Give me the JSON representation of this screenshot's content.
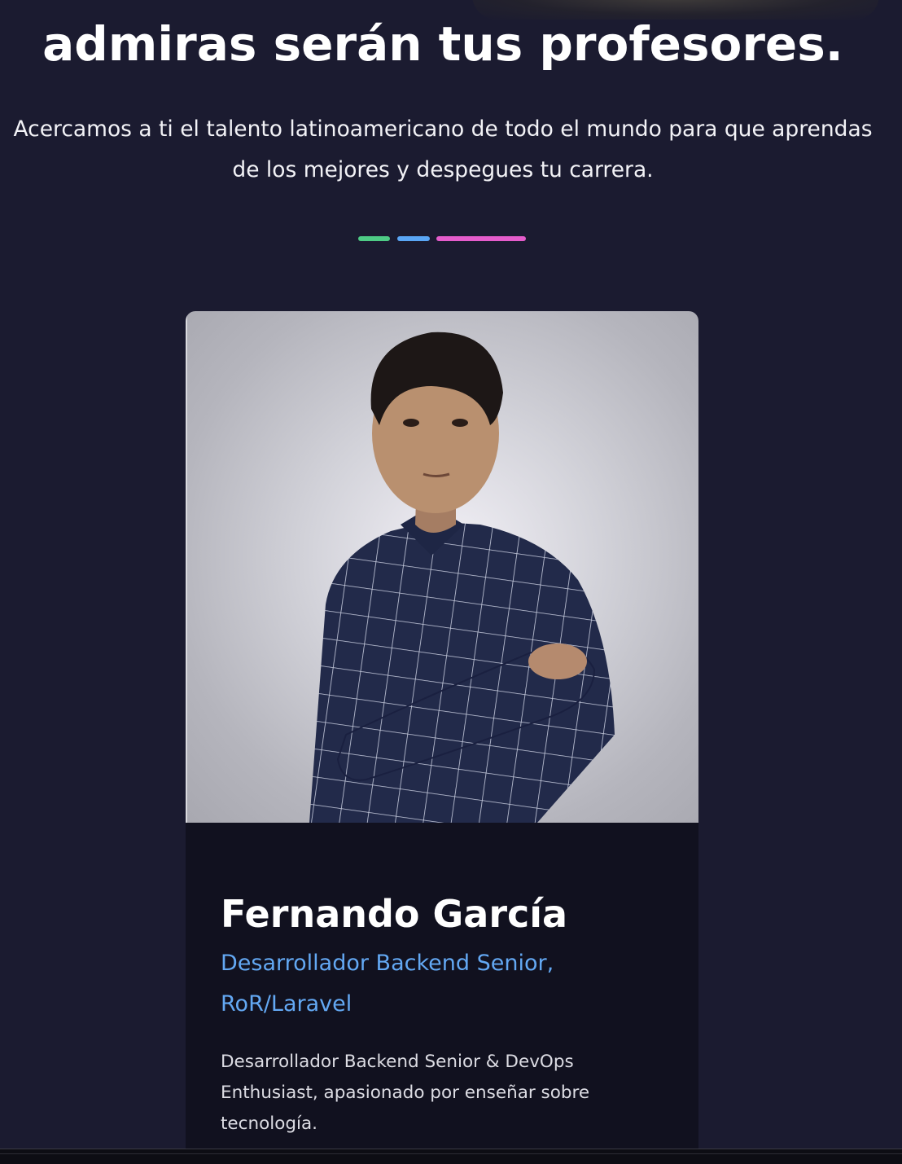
{
  "hero": {
    "headline": "admiras serán tus profesores.",
    "subtitle": "Acercamos a ti el talento latinoamericano de todo el mundo para que aprendas de los mejores y despegues tu carrera."
  },
  "divider_colors": {
    "green": "#4ecb85",
    "blue": "#5aa6f5",
    "pink": "#e55ccb"
  },
  "teacher_card": {
    "name": "Fernando García",
    "role": "Desarrollador Backend Senior, RoR/Laravel",
    "bio": "Desarrollador Backend Senior & DevOps Enthusiast, apasionado por enseñar sobre tecnología.",
    "photo_alt": "Fernando García"
  },
  "colors": {
    "background": "#1b1b30",
    "card_background": "#11111f",
    "role_text": "#63a8f3"
  }
}
